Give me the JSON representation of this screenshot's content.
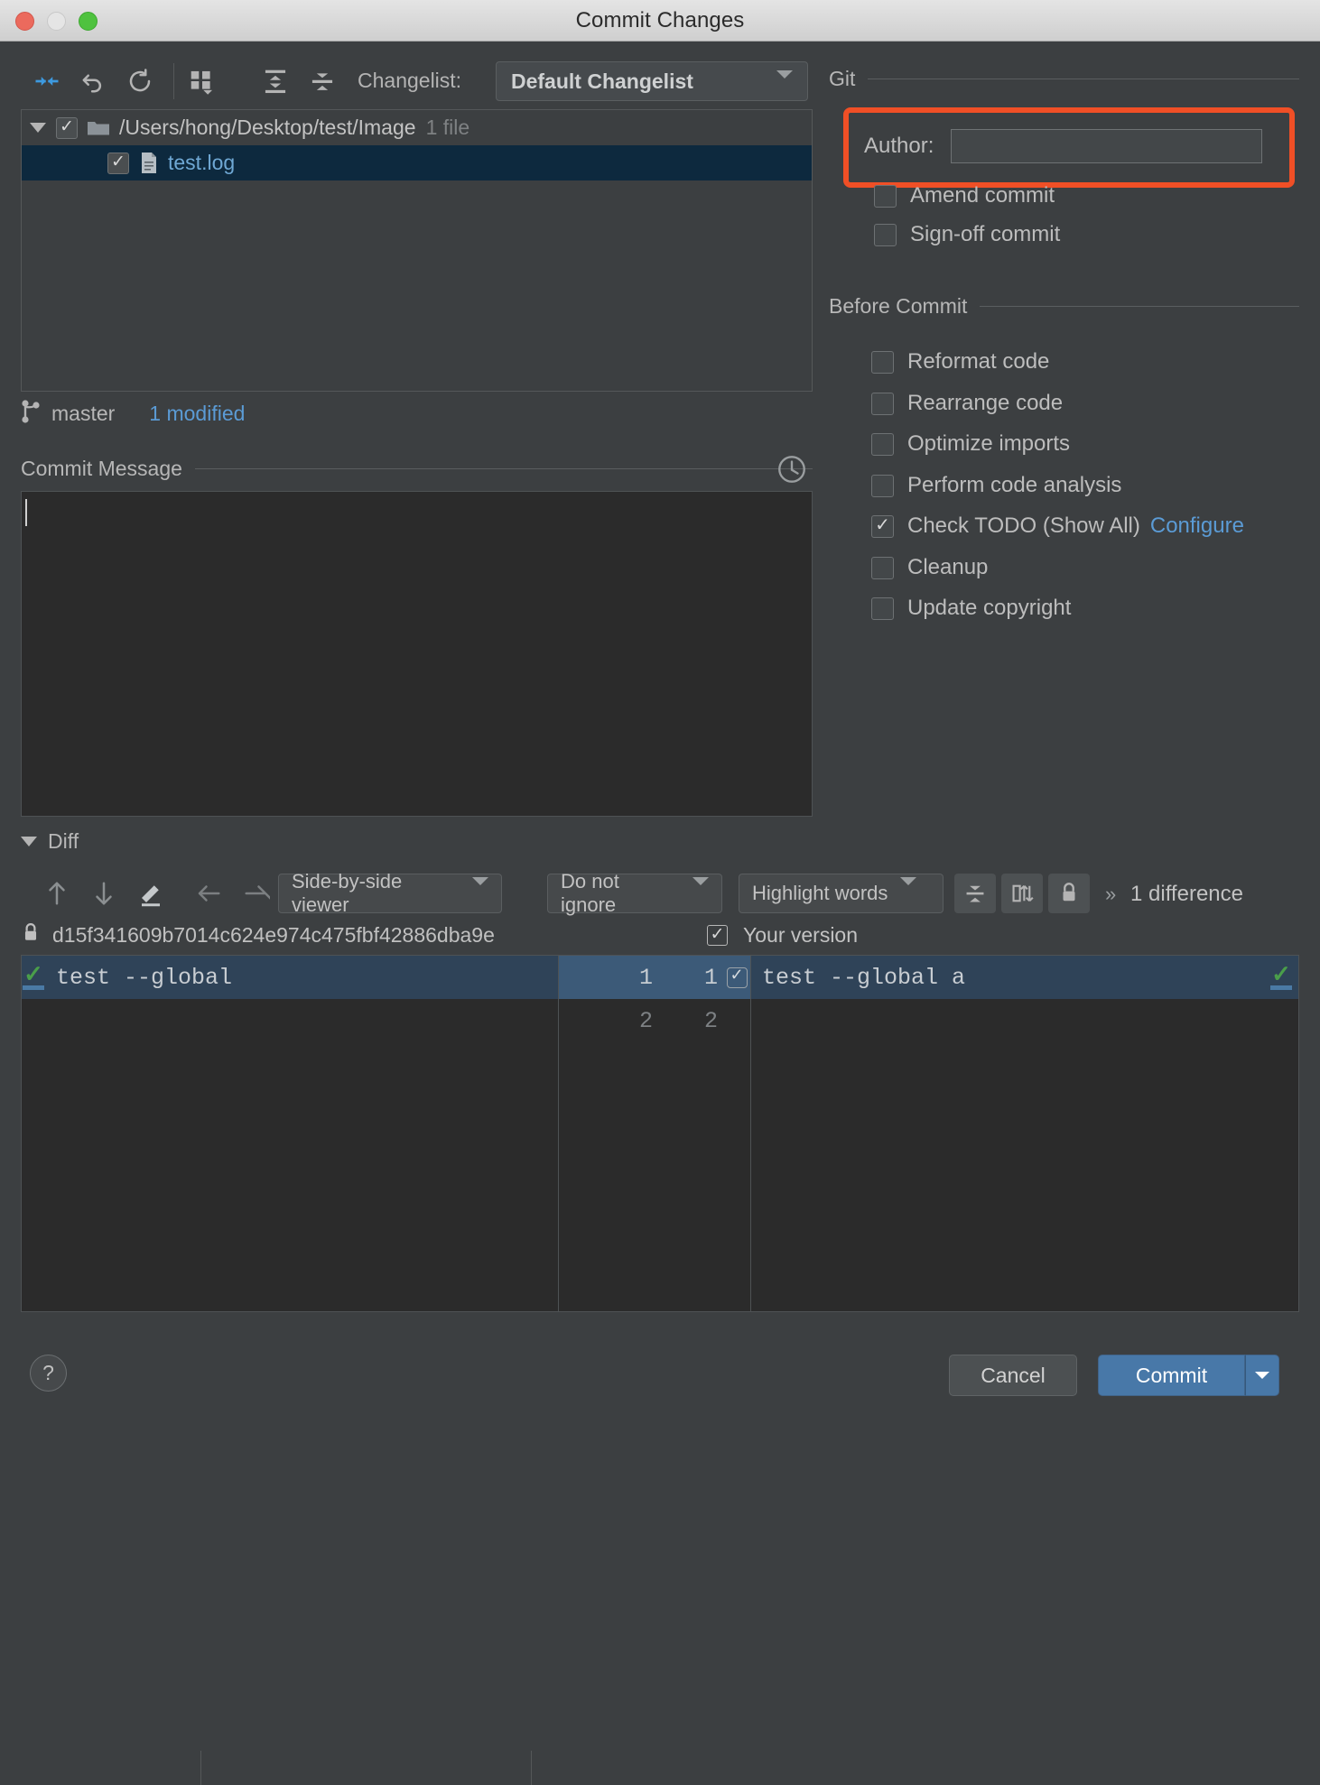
{
  "window": {
    "title": "Commit Changes"
  },
  "traffic": {
    "close": "close-button",
    "minimize": "minimize-button",
    "maximize": "maximize-button"
  },
  "toolbar": {
    "icons": [
      "show-diff-icon",
      "revert-icon",
      "refresh-icon",
      "group-by-icon",
      "expand-all-icon",
      "collapse-all-icon"
    ],
    "changelist_label": "Changelist:",
    "changelist_value": "Default Changelist"
  },
  "filetree": {
    "root": {
      "path": "/Users/hong/Desktop/test/Image",
      "count": "1 file",
      "checked": true,
      "expanded": true
    },
    "files": [
      {
        "name": "test.log",
        "checked": true,
        "selected": true
      }
    ]
  },
  "branch": {
    "name": "master",
    "modified": "1 modified"
  },
  "commit_message": {
    "label": "Commit Message",
    "value": "",
    "placeholder": ""
  },
  "git": {
    "section_label": "Git",
    "author_label": "Author:",
    "author_value": "",
    "options": [
      {
        "label": "Amend commit",
        "checked": false
      },
      {
        "label": "Sign-off commit",
        "checked": false
      }
    ]
  },
  "before_commit": {
    "section_label": "Before Commit",
    "options": [
      {
        "label": "Reformat code",
        "checked": false
      },
      {
        "label": "Rearrange code",
        "checked": false
      },
      {
        "label": "Optimize imports",
        "checked": false
      },
      {
        "label": "Perform code analysis",
        "checked": false
      },
      {
        "label": "Check TODO (Show All)",
        "checked": true,
        "link": "Configure"
      },
      {
        "label": "Cleanup",
        "checked": false
      },
      {
        "label": "Update copyright",
        "checked": false
      }
    ]
  },
  "diff": {
    "section_label": "Diff",
    "viewer_mode": "Side-by-side viewer",
    "ignore_mode": "Do not ignore",
    "highlight_mode": "Highlight words",
    "difference_count": "1 difference",
    "chevron": "»",
    "revision_hash": "d15f341609b7014c624e974c475fbf42886dba9e",
    "your_version_label": "Your version",
    "your_version_checked": true,
    "left_lines": [
      {
        "num": "1",
        "text": "test --global"
      },
      {
        "num": "2",
        "text": ""
      }
    ],
    "right_lines": [
      {
        "num": "1",
        "text": "test --global",
        "added": " a"
      },
      {
        "num": "2",
        "text": "",
        "added": ""
      }
    ]
  },
  "footer": {
    "help": "?",
    "cancel": "Cancel",
    "commit": "Commit"
  },
  "colors": {
    "accent_blue": "#5b9bd5",
    "highlight_red": "#f04f26",
    "added_green": "#2e4736",
    "commit_button": "#4878a8"
  }
}
